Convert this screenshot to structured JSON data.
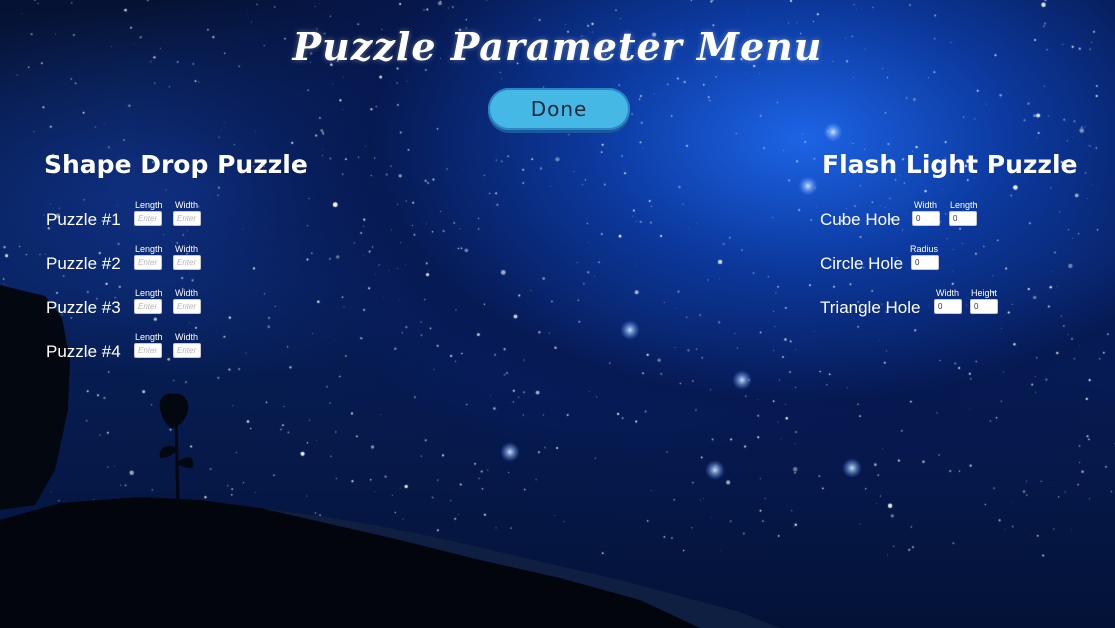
{
  "title": "Puzzle Parameter Menu",
  "done_label": "Done",
  "shape_drop": {
    "title": "Shape Drop Puzzle",
    "rows": [
      {
        "label": "Puzzle #1",
        "length_label": "Length",
        "width_label": "Width",
        "length_placeholder": "Enter",
        "width_placeholder": "Enter"
      },
      {
        "label": "Puzzle #2",
        "length_label": "Length",
        "width_label": "Width",
        "length_placeholder": "Enter",
        "width_placeholder": "Enter"
      },
      {
        "label": "Puzzle #3",
        "length_label": "Length",
        "width_label": "Width",
        "length_placeholder": "Enter",
        "width_placeholder": "Enter"
      },
      {
        "label": "Puzzle #4",
        "length_label": "Length",
        "width_label": "Width",
        "length_placeholder": "Enter",
        "width_placeholder": "Enter"
      }
    ]
  },
  "flash_light": {
    "title": "Flash Light Puzzle",
    "cube": {
      "label": "Cube Hole",
      "width_label": "Width",
      "length_label": "Length",
      "width_value": "0",
      "length_value": "0"
    },
    "circle": {
      "label": "Circle Hole",
      "radius_label": "Radius",
      "radius_value": "0"
    },
    "triangle": {
      "label": "Triangle Hole",
      "width_label": "Width",
      "height_label": "Height",
      "width_value": "0",
      "height_value": "0"
    }
  },
  "colors": {
    "done_button": "#45b8e6",
    "sky_dark": "#051233",
    "nebula": "#1d64e6"
  }
}
